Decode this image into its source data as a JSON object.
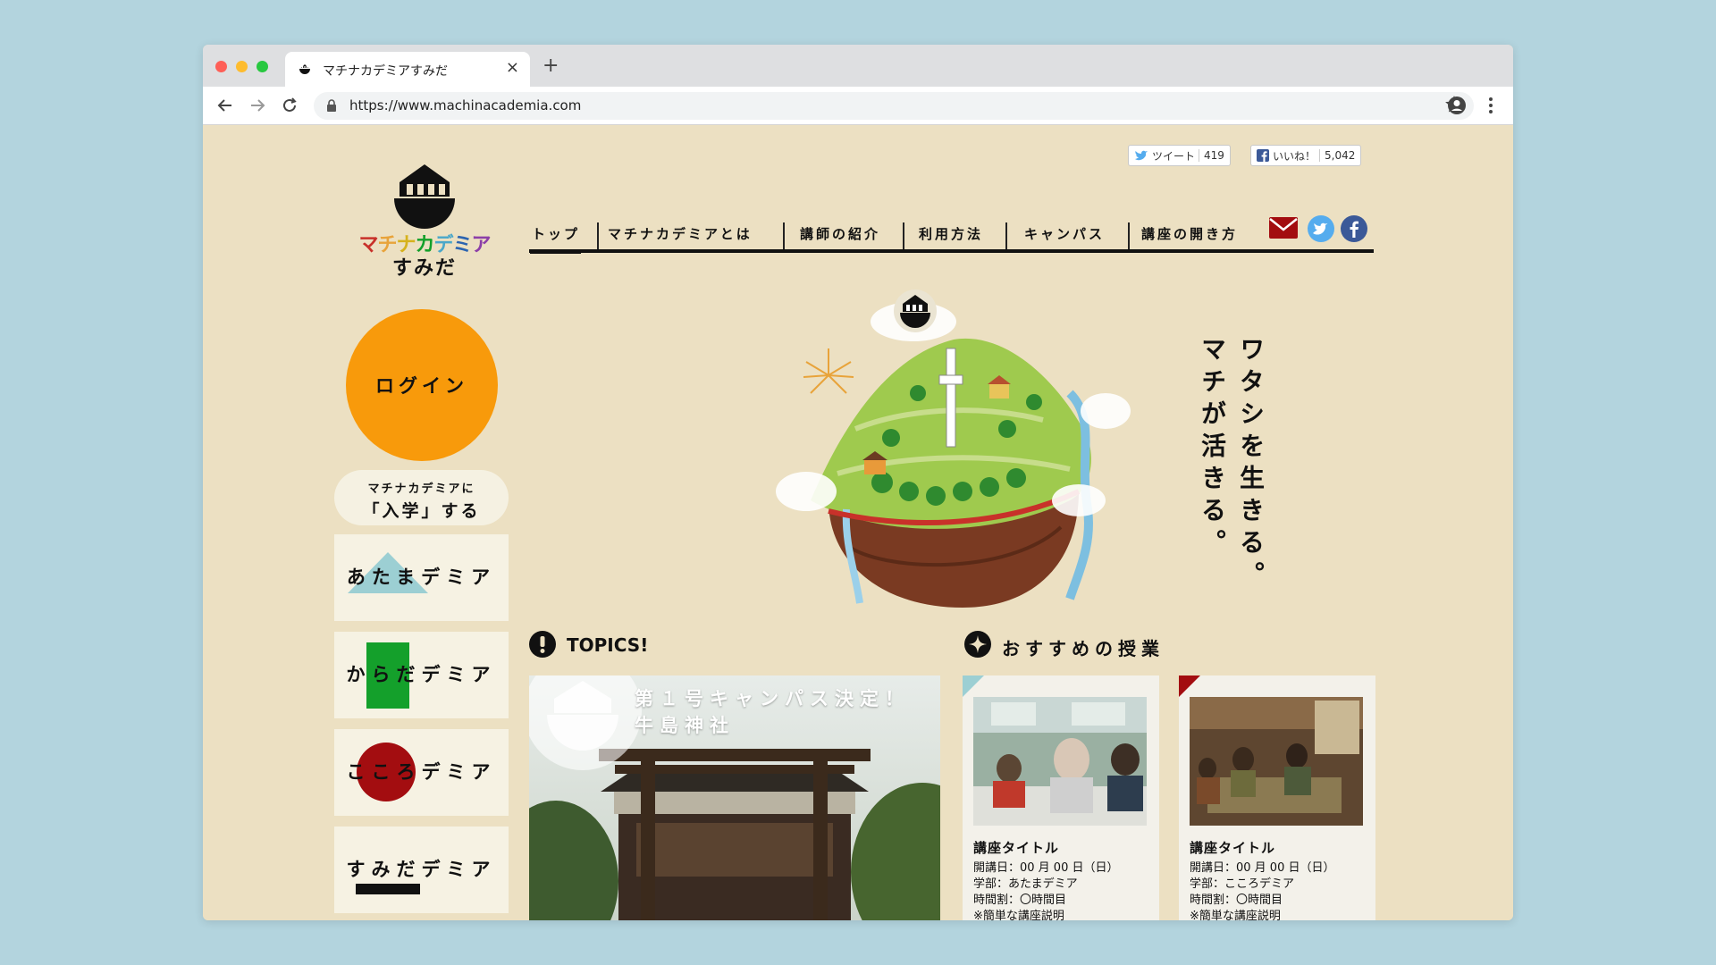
{
  "browser": {
    "tab_title": "マチナカデミアすみだ",
    "url": "https://www.machinacademia.com",
    "new_tab_label": "+",
    "close_label": "×"
  },
  "share": {
    "tweet_label": "ツイート",
    "tweet_count": "419",
    "like_label": "いいね！",
    "like_count": "5,042"
  },
  "logo": {
    "wordmark": "マチナカデミア",
    "subtitle": "すみだ"
  },
  "nav": {
    "items": [
      "トップ",
      "マチナカデミアとは",
      "講師の紹介",
      "利用方法",
      "キャンパス",
      "講座の開き方"
    ],
    "active_index": 0
  },
  "sidebar": {
    "login_label": "ログイン",
    "enroll_line1": "マチナカデミアに",
    "enroll_line2": "「入学」する",
    "departments": [
      {
        "label": "あたまデミア",
        "shape": "triangle",
        "color": "#9ccfd3"
      },
      {
        "label": "からだデミア",
        "shape": "square",
        "color": "#14a02b"
      },
      {
        "label": "こころデミア",
        "shape": "circle",
        "color": "#a30d10"
      },
      {
        "label": "すみだデミア",
        "shape": "bar",
        "color": "#111111"
      }
    ]
  },
  "catchphrase": {
    "line1": "ワタシを生きる。",
    "line2": "マチが活きる。"
  },
  "topics": {
    "heading": "TOPICS!",
    "line1": "第１号キャンパス決定！",
    "line2": "牛島神社"
  },
  "recommended": {
    "heading": "おすすめの授業",
    "cards": [
      {
        "title": "講座タイトル",
        "date": "開講日：00 月 00 日（日）",
        "faculty": "学部：あたまデミア",
        "period": "時間割：〇時間目",
        "note": "※簡単な講座説明",
        "accent": "#9ccfd3"
      },
      {
        "title": "講座タイトル",
        "date": "開講日：00 月 00 日（日）",
        "faculty": "学部：こころデミア",
        "period": "時間割：〇時間目",
        "note": "※簡単な講座説明",
        "accent": "#a30d10"
      }
    ]
  },
  "colors": {
    "page_bg": "#ece0c2",
    "login": "#f89a0b",
    "mail": "#a30d10",
    "twitter": "#55acee",
    "facebook": "#3b5998"
  }
}
